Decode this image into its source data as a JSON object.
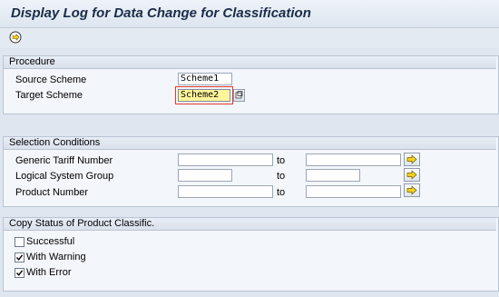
{
  "window": {
    "title": "Display Log for Data Change for Classification"
  },
  "toolbar": {
    "execute_icon": "execute-clock-icon"
  },
  "procedure": {
    "title": "Procedure",
    "source_scheme_label": "Source Scheme",
    "source_scheme_value": "Scheme1",
    "target_scheme_label": "Target Scheme",
    "target_scheme_value": "Scheme2"
  },
  "selection": {
    "title": "Selection Conditions",
    "to_label": "to",
    "rows": [
      {
        "label": "Generic Tariff Number",
        "from": "",
        "to": ""
      },
      {
        "label": "Logical System Group",
        "from": "",
        "to": ""
      },
      {
        "label": "Product Number",
        "from": "",
        "to": ""
      }
    ]
  },
  "copy_status": {
    "title": "Copy Status of Product Classific.",
    "items": [
      {
        "label": "Successful",
        "checked": false
      },
      {
        "label": "With Warning",
        "checked": true
      },
      {
        "label": "With Error",
        "checked": true
      }
    ]
  },
  "colors": {
    "background": "#dfe6ef",
    "focus_field": "#fff59a",
    "arrow_yellow": "#f6d21c",
    "title_text": "#1b2c49"
  }
}
